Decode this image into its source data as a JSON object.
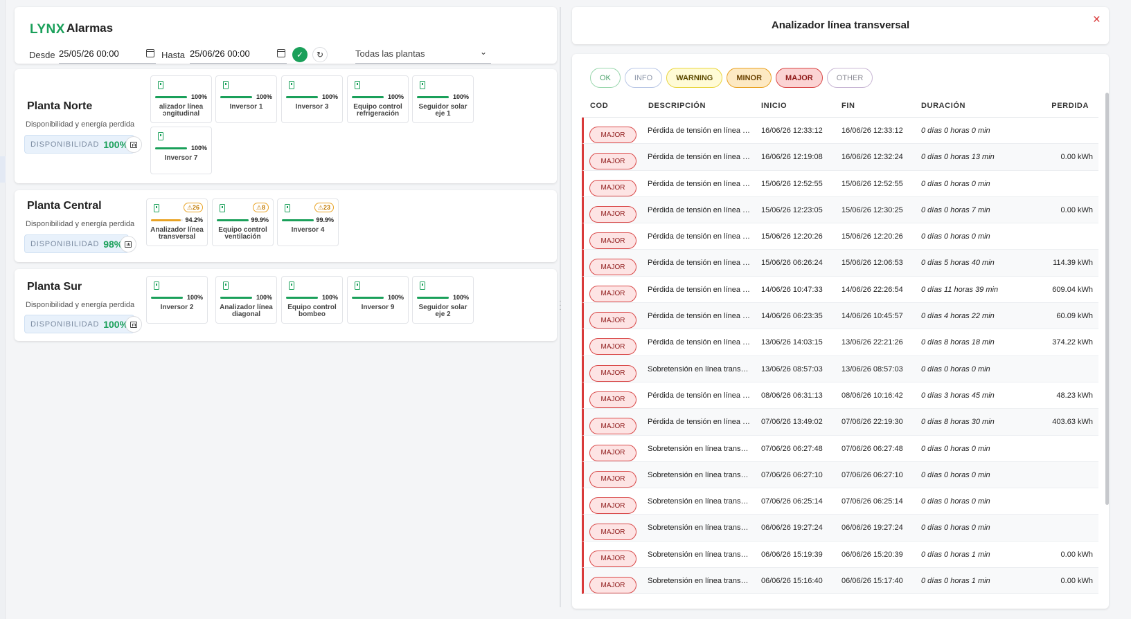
{
  "header": {
    "brand": "LYNX",
    "title": "Alarmas",
    "from_label": "Desde",
    "from_value": "25/05/26 00:00",
    "to_label": "Hasta",
    "to_value": "25/06/26 00:00",
    "plant_select": "Todas las plantas"
  },
  "plants": [
    {
      "name": "Planta Norte",
      "subtitle": "Disponibilidad y energía perdida",
      "disp_label": "DISPONIBILIDAD",
      "disp_value": "100%",
      "devices": [
        {
          "name": "alizador línea ɔngitudinal",
          "pct": "100%",
          "fill": 1.0,
          "alert": ""
        },
        {
          "name": "Inversor 1",
          "pct": "100%",
          "fill": 1.0,
          "alert": ""
        },
        {
          "name": "Inversor 3",
          "pct": "100%",
          "fill": 1.0,
          "alert": ""
        },
        {
          "name": "Equipo control refrigeración",
          "pct": "100%",
          "fill": 1.0,
          "alert": ""
        },
        {
          "name": "Seguidor solar eje 1",
          "pct": "100%",
          "fill": 1.0,
          "alert": ""
        },
        {
          "name": "Inversor 7",
          "pct": "100%",
          "fill": 1.0,
          "alert": ""
        }
      ]
    },
    {
      "name": "Planta Central",
      "subtitle": "Disponibilidad y energía perdida",
      "disp_label": "DISPONIBILIDAD",
      "disp_value": "98%",
      "devices": [
        {
          "name": "Analizador línea transversal",
          "pct": "94.2%",
          "fill": 0.942,
          "alert": "⚠26"
        },
        {
          "name": "Equipo control ventilación",
          "pct": "99.9%",
          "fill": 0.999,
          "alert": "⚠8"
        },
        {
          "name": "Inversor 4",
          "pct": "99.9%",
          "fill": 0.999,
          "alert": "⚠23"
        }
      ]
    },
    {
      "name": "Planta Sur",
      "subtitle": "Disponibilidad y energía perdida",
      "disp_label": "DISPONIBILIDAD",
      "disp_value": "100%",
      "devices": [
        {
          "name": "Inversor 2",
          "pct": "100%",
          "fill": 1.0,
          "alert": ""
        },
        {
          "name": "Analizador línea diagonal",
          "pct": "100%",
          "fill": 1.0,
          "alert": ""
        },
        {
          "name": "Equipo control bombeo",
          "pct": "100%",
          "fill": 1.0,
          "alert": ""
        },
        {
          "name": "Inversor 9",
          "pct": "100%",
          "fill": 1.0,
          "alert": ""
        },
        {
          "name": "Seguidor solar eje 2",
          "pct": "100%",
          "fill": 1.0,
          "alert": ""
        }
      ]
    }
  ],
  "panel": {
    "title": "Analizador línea transversal",
    "close": "×",
    "filters": [
      "OK",
      "INFO",
      "WARNING",
      "MINOR",
      "MAJOR",
      "OTHER"
    ],
    "columns": [
      "COD",
      "DESCRIPCIÓN",
      "INICIO",
      "FIN",
      "DURACIÓN",
      "PERDIDA"
    ],
    "rows": [
      {
        "cod": "MAJOR",
        "desc": "Pérdida de tensión en línea transversal",
        "ini": "16/06/26 12:33:12",
        "fin": "16/06/26 12:33:12",
        "dur": "0 días 0 horas 0 min",
        "per": ""
      },
      {
        "cod": "MAJOR",
        "desc": "Pérdida de tensión en línea transversal",
        "ini": "16/06/26 12:19:08",
        "fin": "16/06/26 12:32:24",
        "dur": "0 días 0 horas 13 min",
        "per": "0.00 kWh"
      },
      {
        "cod": "MAJOR",
        "desc": "Pérdida de tensión en línea transversal",
        "ini": "15/06/26 12:52:55",
        "fin": "15/06/26 12:52:55",
        "dur": "0 días 0 horas 0 min",
        "per": ""
      },
      {
        "cod": "MAJOR",
        "desc": "Pérdida de tensión en línea transversal",
        "ini": "15/06/26 12:23:05",
        "fin": "15/06/26 12:30:25",
        "dur": "0 días 0 horas 7 min",
        "per": "0.00 kWh"
      },
      {
        "cod": "MAJOR",
        "desc": "Pérdida de tensión en línea transversal",
        "ini": "15/06/26 12:20:26",
        "fin": "15/06/26 12:20:26",
        "dur": "0 días 0 horas 0 min",
        "per": ""
      },
      {
        "cod": "MAJOR",
        "desc": "Pérdida de tensión en línea transversal",
        "ini": "15/06/26 06:26:24",
        "fin": "15/06/26 12:06:53",
        "dur": "0 días 5 horas 40 min",
        "per": "114.39 kWh"
      },
      {
        "cod": "MAJOR",
        "desc": "Pérdida de tensión en línea transversal",
        "ini": "14/06/26 10:47:33",
        "fin": "14/06/26 22:26:54",
        "dur": "0 días 11 horas 39 min",
        "per": "609.04 kWh"
      },
      {
        "cod": "MAJOR",
        "desc": "Pérdida de tensión en línea transversal",
        "ini": "14/06/26 06:23:35",
        "fin": "14/06/26 10:45:57",
        "dur": "0 días 4 horas 22 min",
        "per": "60.09 kWh"
      },
      {
        "cod": "MAJOR",
        "desc": "Pérdida de tensión en línea transversal",
        "ini": "13/06/26 14:03:15",
        "fin": "13/06/26 22:21:26",
        "dur": "0 días 8 horas 18 min",
        "per": "374.22 kWh"
      },
      {
        "cod": "MAJOR",
        "desc": "Sobretensión en línea transversal",
        "ini": "13/06/26 08:57:03",
        "fin": "13/06/26 08:57:03",
        "dur": "0 días 0 horas 0 min",
        "per": ""
      },
      {
        "cod": "MAJOR",
        "desc": "Pérdida de tensión en línea transversal",
        "ini": "08/06/26 06:31:13",
        "fin": "08/06/26 10:16:42",
        "dur": "0 días 3 horas 45 min",
        "per": "48.23 kWh"
      },
      {
        "cod": "MAJOR",
        "desc": "Pérdida de tensión en línea transversal",
        "ini": "07/06/26 13:49:02",
        "fin": "07/06/26 22:19:30",
        "dur": "0 días 8 horas 30 min",
        "per": "403.63 kWh"
      },
      {
        "cod": "MAJOR",
        "desc": "Sobretensión en línea transversal",
        "ini": "07/06/26 06:27:48",
        "fin": "07/06/26 06:27:48",
        "dur": "0 días 0 horas 0 min",
        "per": ""
      },
      {
        "cod": "MAJOR",
        "desc": "Sobretensión en línea transversal",
        "ini": "07/06/26 06:27:10",
        "fin": "07/06/26 06:27:10",
        "dur": "0 días 0 horas 0 min",
        "per": ""
      },
      {
        "cod": "MAJOR",
        "desc": "Sobretensión en línea transversal",
        "ini": "07/06/26 06:25:14",
        "fin": "07/06/26 06:25:14",
        "dur": "0 días 0 horas 0 min",
        "per": ""
      },
      {
        "cod": "MAJOR",
        "desc": "Sobretensión en línea transversal",
        "ini": "06/06/26 19:27:24",
        "fin": "06/06/26 19:27:24",
        "dur": "0 días 0 horas 0 min",
        "per": ""
      },
      {
        "cod": "MAJOR",
        "desc": "Sobretensión en línea transversal",
        "ini": "06/06/26 15:19:39",
        "fin": "06/06/26 15:20:39",
        "dur": "0 días 0 horas 1 min",
        "per": "0.00 kWh"
      },
      {
        "cod": "MAJOR",
        "desc": "Sobretensión en línea transversal",
        "ini": "06/06/26 15:16:40",
        "fin": "06/06/26 15:17:40",
        "dur": "0 días 0 horas 1 min",
        "per": "0.00 kWh"
      }
    ]
  }
}
